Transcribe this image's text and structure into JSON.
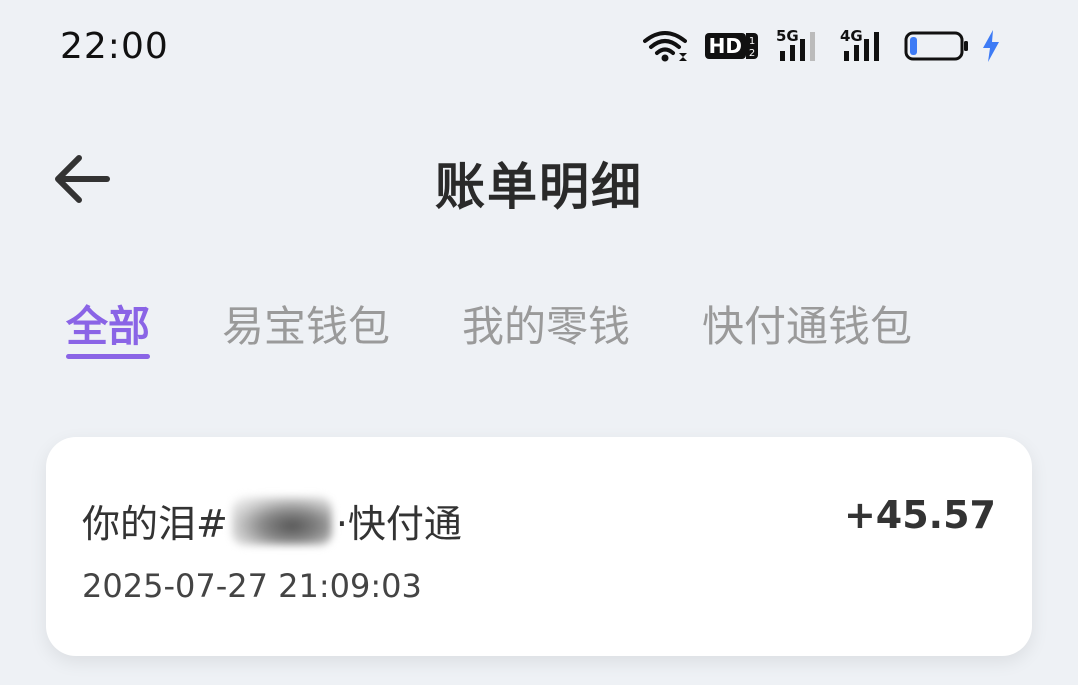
{
  "status_bar": {
    "time": "22:00",
    "hd_label": "HD",
    "signal_5g_label": "5G",
    "signal_4g_label": "4G",
    "icons": [
      "wifi-icon",
      "hd-voice-icon",
      "signal-5g-icon",
      "signal-4g-icon",
      "battery-icon",
      "charging-icon"
    ],
    "battery_level": 0.12,
    "charging_color": "#3d7bf5"
  },
  "nav": {
    "title": "账单明细",
    "back_icon": "arrow-left-icon"
  },
  "tabs": [
    {
      "label": "全部",
      "active": true
    },
    {
      "label": "易宝钱包",
      "active": false
    },
    {
      "label": "我的零钱",
      "active": false
    },
    {
      "label": "快付通钱包",
      "active": false
    }
  ],
  "accent_color": "#8a64e6",
  "bills": [
    {
      "name_prefix": "你的泪#",
      "name_suffix": "·快付通",
      "amount": "+45.57",
      "time": "2025-07-27 21:09:03"
    }
  ]
}
